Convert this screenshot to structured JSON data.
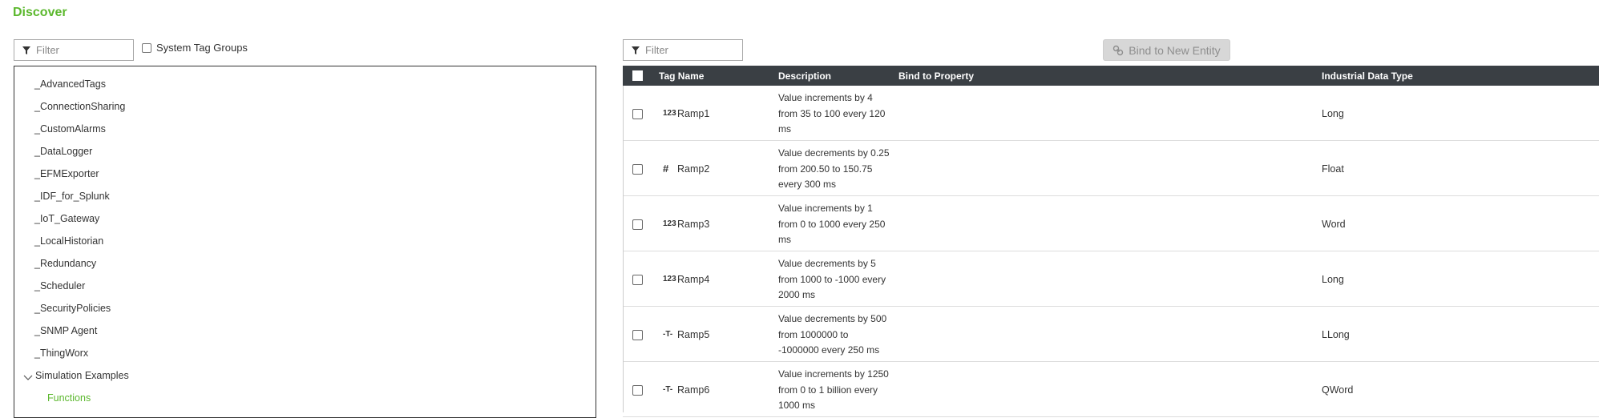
{
  "page": {
    "title": "Discover"
  },
  "left_panel": {
    "filter_placeholder": "Filter",
    "system_tag_groups_label": "System Tag Groups",
    "tree_items": [
      "_AdvancedTags",
      "_ConnectionSharing",
      "_CustomAlarms",
      "_DataLogger",
      "_EFMExporter",
      "_IDF_for_Splunk",
      "_IoT_Gateway",
      "_LocalHistorian",
      "_Redundancy",
      "_Scheduler",
      "_SecurityPolicies",
      "_SNMP Agent",
      "_ThingWorx",
      "Simulation Examples",
      "Functions"
    ]
  },
  "right_panel": {
    "filter_placeholder": "Filter",
    "bind_button_label": "Bind to New Entity",
    "columns": [
      "Tag Name",
      "Description",
      "Bind to Property",
      "Industrial Data Type"
    ],
    "rows": [
      {
        "icon": "integer-icon",
        "icon_glyph": "123",
        "name": "Ramp1",
        "description": "Value increments by 4 from 35 to 100 every 120 ms",
        "bind": "",
        "type": "Long"
      },
      {
        "icon": "float-icon",
        "icon_glyph": "#",
        "name": "Ramp2",
        "description": "Value decrements by 0.25 from 200.50 to 150.75 every 300 ms",
        "bind": "",
        "type": "Float"
      },
      {
        "icon": "integer-icon",
        "icon_glyph": "123",
        "name": "Ramp3",
        "description": "Value increments by 1 from 0 to 1000 every 250 ms",
        "bind": "",
        "type": "Word"
      },
      {
        "icon": "integer-icon",
        "icon_glyph": "123",
        "name": "Ramp4",
        "description": "Value decrements by 5 from 1000 to -1000 every 2000 ms",
        "bind": "",
        "type": "Long"
      },
      {
        "icon": "text-icon",
        "icon_glyph": "-T-",
        "name": "Ramp5",
        "description": "Value decrements by 500 from 1000000 to -1000000 every 250 ms",
        "bind": "",
        "type": "LLong"
      },
      {
        "icon": "text-icon",
        "icon_glyph": "-T-",
        "name": "Ramp6",
        "description": "Value increments by 1250 from 0 to 1 billion every 1000 ms",
        "bind": "",
        "type": "QWord"
      }
    ]
  },
  "colors": {
    "accent": "#5cb82e",
    "header_bg": "#3a3f44",
    "button_disabled": "#d7d7d7"
  }
}
